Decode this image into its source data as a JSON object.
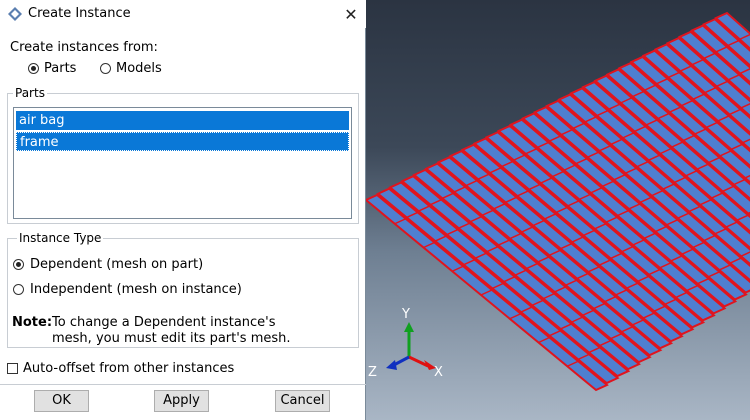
{
  "dialog": {
    "title": "Create Instance",
    "create_from_label": "Create instances from:",
    "source_options": [
      {
        "label": "Parts",
        "selected": true
      },
      {
        "label": "Models",
        "selected": false
      }
    ],
    "parts_group_title": "Parts",
    "parts_list": [
      "air bag",
      "frame"
    ],
    "instance_type_title": "Instance Type",
    "instance_types": [
      {
        "label": "Dependent (mesh on part)",
        "selected": true
      },
      {
        "label": "Independent (mesh on instance)",
        "selected": false
      }
    ],
    "note_label": "Note:",
    "note_line1": "To change a Dependent instance's",
    "note_line2": "mesh, you must edit its part's mesh.",
    "auto_offset_label": "Auto-offset from other instances",
    "auto_offset_checked": false,
    "buttons": {
      "ok": "OK",
      "apply": "Apply",
      "cancel": "Cancel"
    }
  },
  "viewport": {
    "triad": {
      "y": "Y",
      "z": "Z",
      "x": "X"
    },
    "colors": {
      "mesh_edge": "#e0141e",
      "mesh_face": "#4f7fd0",
      "x_axis": "#e01010",
      "y_axis": "#10a020",
      "z_axis": "#1030c0"
    }
  }
}
